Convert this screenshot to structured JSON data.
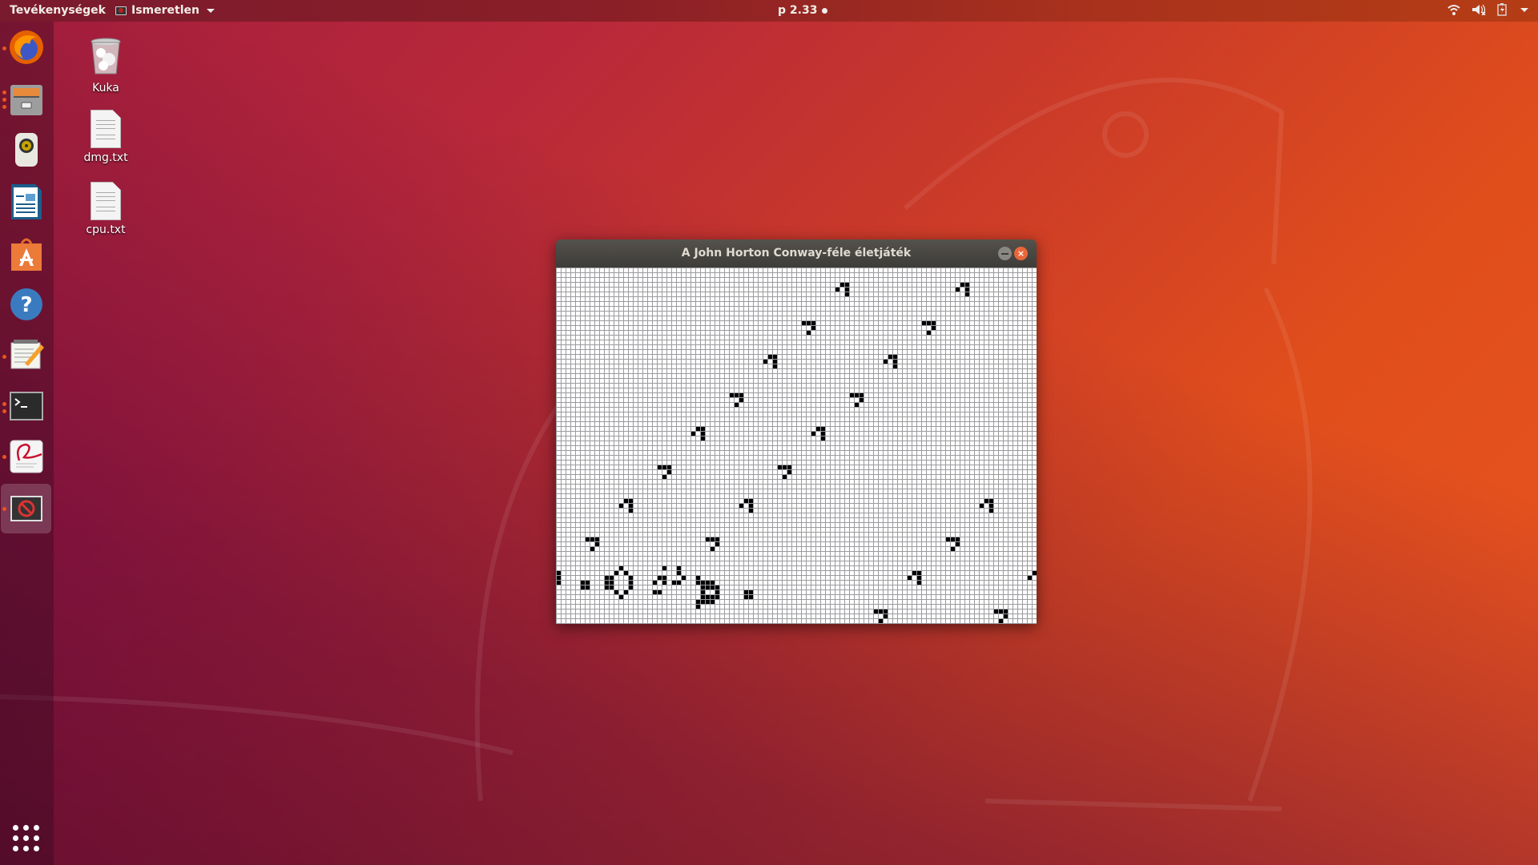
{
  "topbar": {
    "activities": "Tevékenységek",
    "app_menu": "Ismeretlen",
    "clock": "p 2.33",
    "tray": [
      "wifi-icon",
      "volume-muted-icon",
      "battery-charging-icon",
      "system-menu-caret"
    ]
  },
  "dock": {
    "items": [
      {
        "name": "firefox",
        "running": true
      },
      {
        "name": "files",
        "running": true
      },
      {
        "name": "rhythmbox",
        "running": false
      },
      {
        "name": "libreoffice-writer",
        "running": false
      },
      {
        "name": "software-center",
        "running": false
      },
      {
        "name": "help",
        "running": false
      },
      {
        "name": "text-editor",
        "running": true
      },
      {
        "name": "terminal",
        "running": true
      },
      {
        "name": "document-viewer",
        "running": true
      },
      {
        "name": "unknown-app",
        "running": true,
        "active": true
      }
    ]
  },
  "desktop": {
    "icons": [
      {
        "label": "Kuka",
        "type": "trash"
      },
      {
        "label": "dmg.txt",
        "type": "text"
      },
      {
        "label": "cpu.txt",
        "type": "text"
      }
    ]
  },
  "window": {
    "title": "A John Horton Conway-féle életjáték",
    "close_glyph": "×"
  },
  "game": {
    "columns": 100,
    "rows": 74,
    "live_cells": [
      [
        44,
        18
      ],
      [
        45,
        18
      ],
      [
        43,
        19
      ],
      [
        45,
        19
      ],
      [
        45,
        20
      ],
      [
        36,
        26
      ],
      [
        37,
        26
      ],
      [
        38,
        26
      ],
      [
        38,
        27
      ],
      [
        37,
        28
      ],
      [
        29,
        33
      ],
      [
        30,
        33
      ],
      [
        28,
        34
      ],
      [
        30,
        34
      ],
      [
        30,
        35
      ],
      [
        59,
        3
      ],
      [
        60,
        3
      ],
      [
        58,
        4
      ],
      [
        60,
        4
      ],
      [
        60,
        5
      ],
      [
        84,
        3
      ],
      [
        85,
        3
      ],
      [
        83,
        4
      ],
      [
        85,
        4
      ],
      [
        85,
        5
      ],
      [
        51,
        11
      ],
      [
        52,
        11
      ],
      [
        53,
        11
      ],
      [
        53,
        12
      ],
      [
        52,
        13
      ],
      [
        76,
        11
      ],
      [
        77,
        11
      ],
      [
        78,
        11
      ],
      [
        78,
        12
      ],
      [
        77,
        13
      ],
      [
        69,
        18
      ],
      [
        70,
        18
      ],
      [
        68,
        19
      ],
      [
        70,
        19
      ],
      [
        70,
        20
      ],
      [
        61,
        26
      ],
      [
        62,
        26
      ],
      [
        63,
        26
      ],
      [
        63,
        27
      ],
      [
        62,
        28
      ],
      [
        54,
        33
      ],
      [
        55,
        33
      ],
      [
        53,
        34
      ],
      [
        55,
        34
      ],
      [
        55,
        35
      ],
      [
        21,
        41
      ],
      [
        22,
        41
      ],
      [
        23,
        41
      ],
      [
        23,
        42
      ],
      [
        22,
        43
      ],
      [
        46,
        41
      ],
      [
        47,
        41
      ],
      [
        48,
        41
      ],
      [
        48,
        42
      ],
      [
        47,
        43
      ],
      [
        14,
        48
      ],
      [
        15,
        48
      ],
      [
        13,
        49
      ],
      [
        15,
        49
      ],
      [
        15,
        50
      ],
      [
        39,
        48
      ],
      [
        40,
        48
      ],
      [
        38,
        49
      ],
      [
        40,
        49
      ],
      [
        40,
        50
      ],
      [
        6,
        56
      ],
      [
        7,
        56
      ],
      [
        8,
        56
      ],
      [
        8,
        57
      ],
      [
        7,
        58
      ],
      [
        31,
        56
      ],
      [
        32,
        56
      ],
      [
        33,
        56
      ],
      [
        33,
        57
      ],
      [
        32,
        58
      ],
      [
        89,
        48
      ],
      [
        90,
        48
      ],
      [
        88,
        49
      ],
      [
        90,
        49
      ],
      [
        90,
        50
      ],
      [
        81,
        56
      ],
      [
        82,
        56
      ],
      [
        83,
        56
      ],
      [
        83,
        57
      ],
      [
        82,
        58
      ],
      [
        74,
        63
      ],
      [
        75,
        63
      ],
      [
        73,
        64
      ],
      [
        75,
        64
      ],
      [
        75,
        65
      ],
      [
        99,
        63
      ],
      [
        98,
        64
      ],
      [
        66,
        71
      ],
      [
        67,
        71
      ],
      [
        68,
        71
      ],
      [
        68,
        72
      ],
      [
        67,
        73
      ],
      [
        91,
        71
      ],
      [
        92,
        71
      ],
      [
        93,
        71
      ],
      [
        93,
        72
      ],
      [
        92,
        73
      ],
      [
        0,
        63
      ],
      [
        0,
        64
      ],
      [
        0,
        65
      ],
      [
        5,
        65
      ],
      [
        6,
        65
      ],
      [
        5,
        66
      ],
      [
        6,
        66
      ],
      [
        13,
        62
      ],
      [
        12,
        63
      ],
      [
        14,
        63
      ],
      [
        10,
        64
      ],
      [
        11,
        64
      ],
      [
        15,
        64
      ],
      [
        10,
        65
      ],
      [
        11,
        65
      ],
      [
        15,
        65
      ],
      [
        10,
        66
      ],
      [
        11,
        66
      ],
      [
        15,
        66
      ],
      [
        12,
        67
      ],
      [
        14,
        67
      ],
      [
        13,
        68
      ],
      [
        22,
        62
      ],
      [
        25,
        62
      ],
      [
        25,
        63
      ],
      [
        21,
        64
      ],
      [
        22,
        64
      ],
      [
        26,
        64
      ],
      [
        20,
        65
      ],
      [
        22,
        65
      ],
      [
        24,
        65
      ],
      [
        25,
        65
      ],
      [
        20,
        67
      ],
      [
        21,
        67
      ],
      [
        29,
        64
      ],
      [
        29,
        65
      ],
      [
        30,
        65
      ],
      [
        31,
        65
      ],
      [
        32,
        65
      ],
      [
        30,
        66
      ],
      [
        31,
        66
      ],
      [
        32,
        66
      ],
      [
        33,
        66
      ],
      [
        30,
        67
      ],
      [
        33,
        67
      ],
      [
        30,
        68
      ],
      [
        31,
        68
      ],
      [
        32,
        68
      ],
      [
        33,
        68
      ],
      [
        29,
        69
      ],
      [
        30,
        69
      ],
      [
        31,
        69
      ],
      [
        32,
        69
      ],
      [
        29,
        70
      ],
      [
        39,
        67
      ],
      [
        40,
        67
      ],
      [
        39,
        68
      ],
      [
        40,
        68
      ]
    ]
  }
}
